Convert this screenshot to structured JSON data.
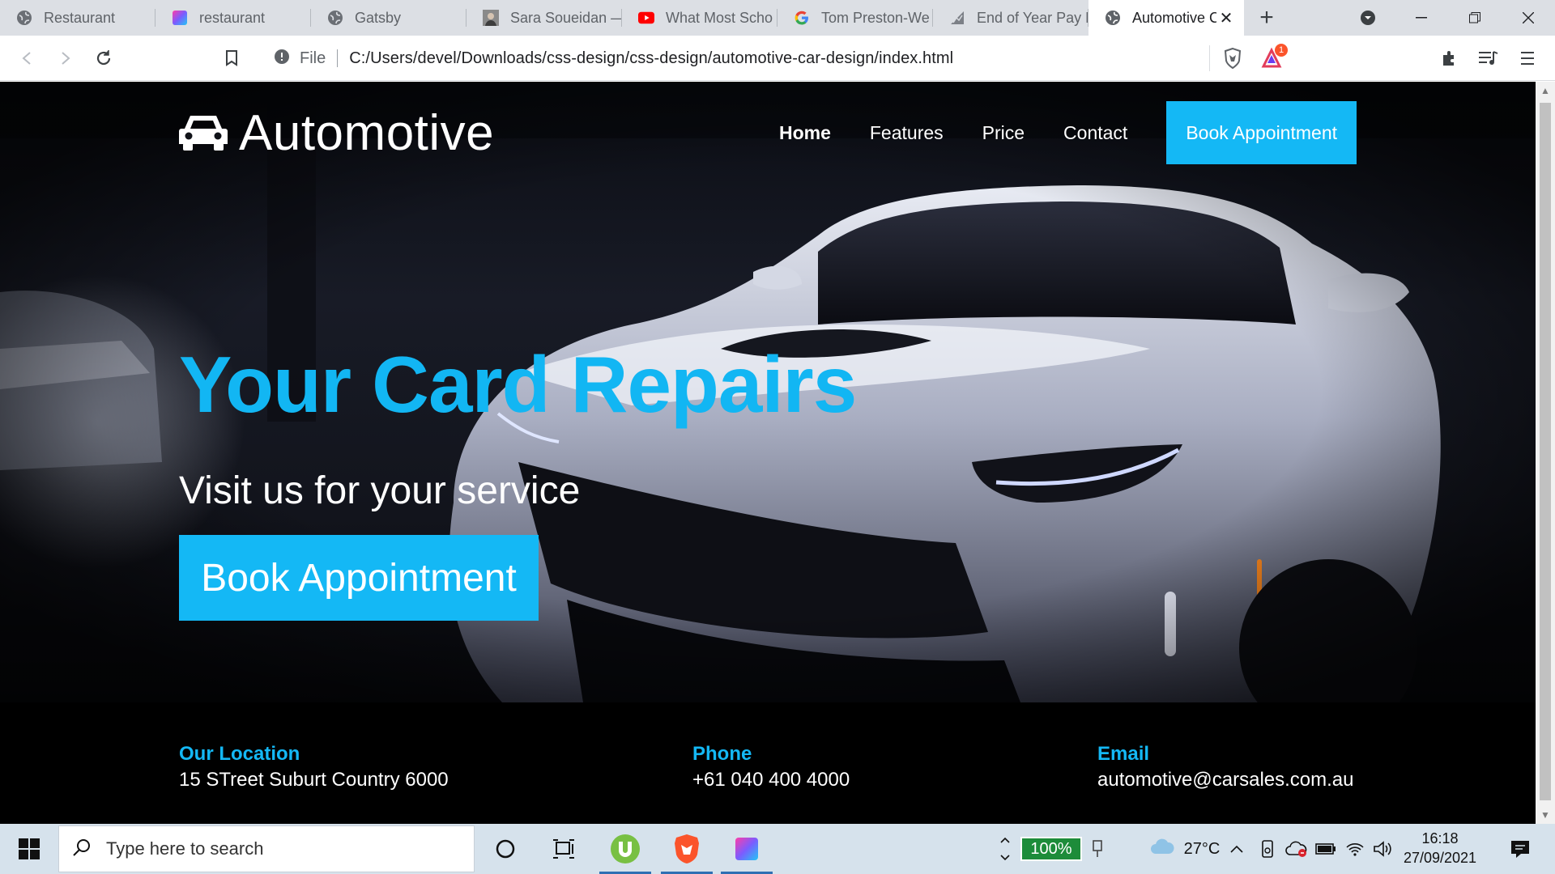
{
  "browser": {
    "tabs": [
      {
        "title": "Restaurant",
        "icon": "globe-icon"
      },
      {
        "title": "restaurant",
        "icon": "colorful-square-icon"
      },
      {
        "title": "Gatsby",
        "icon": "globe-icon"
      },
      {
        "title": "Sara Soueidan —",
        "icon": "avatar-icon"
      },
      {
        "title": "What Most Scho",
        "icon": "youtube-icon"
      },
      {
        "title": "Tom Preston-We",
        "icon": "google-icon"
      },
      {
        "title": "End of Year Pay R",
        "icon": "document-icon"
      },
      {
        "title": "Automotive C",
        "icon": "globe-icon",
        "active": true
      }
    ],
    "new_tab_label": "+",
    "address": {
      "scheme_label": "File",
      "url": "C:/Users/devel/Downloads/css-design/css-design/automotive-car-design/index.html"
    },
    "rewards_badge": "1"
  },
  "site": {
    "logo_text": "Automotive",
    "nav": {
      "links": [
        "Home",
        "Features",
        "Price",
        "Contact"
      ],
      "active": "Home",
      "cta": "Book Appointment"
    },
    "hero": {
      "title": "Your Card Repairs",
      "subtitle": "Visit us for your service",
      "cta": "Book Appointment"
    },
    "footer": {
      "location": {
        "heading": "Our Location",
        "value": "15 STreet Suburt Country 6000"
      },
      "phone": {
        "heading": "Phone",
        "value": "+61 040 400 4000"
      },
      "email": {
        "heading": "Email",
        "value": "automotive@carsales.com.au"
      }
    },
    "colors": {
      "accent": "#14b8f5",
      "footer_bg": "#000000",
      "text": "#ffffff"
    }
  },
  "taskbar": {
    "search_placeholder": "Type here to search",
    "battery_level": "100%",
    "weather": "27°C",
    "time": "16:18",
    "date": "27/09/2021"
  }
}
